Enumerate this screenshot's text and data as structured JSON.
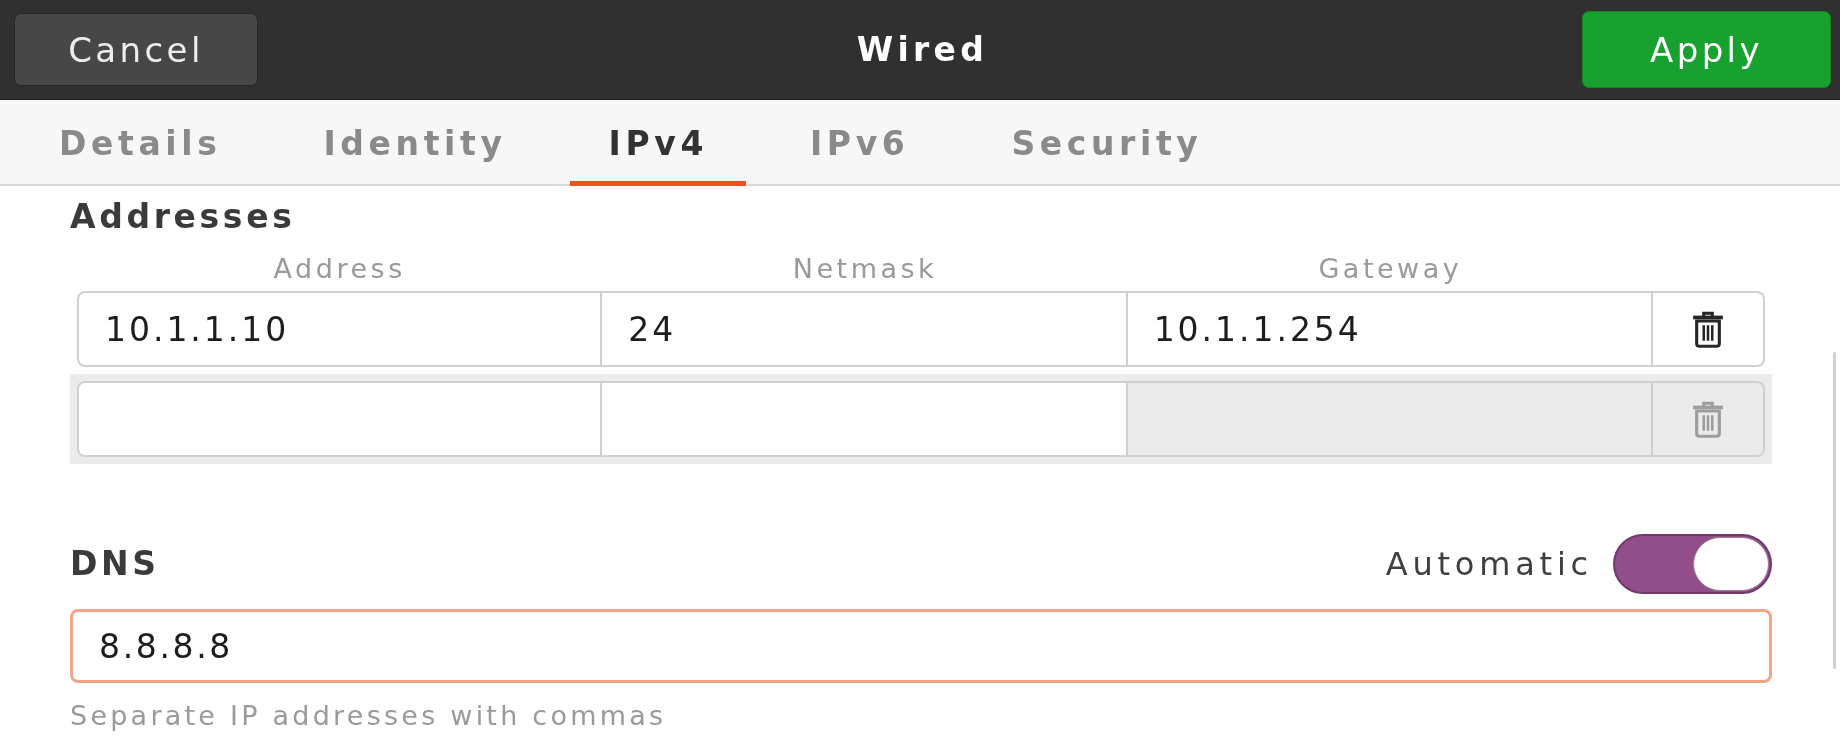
{
  "header": {
    "cancel": "Cancel",
    "title": "Wired",
    "apply": "Apply"
  },
  "tabs": [
    {
      "label": "Details",
      "selected": false
    },
    {
      "label": "Identity",
      "selected": false
    },
    {
      "label": "IPv4",
      "selected": true
    },
    {
      "label": "IPv6",
      "selected": false
    },
    {
      "label": "Security",
      "selected": false
    }
  ],
  "addresses": {
    "title": "Addresses",
    "columns": [
      "Address",
      "Netmask",
      "Gateway"
    ],
    "rows": [
      {
        "highlighted": false,
        "address": "10.1.1.10",
        "netmask": "24",
        "gateway": "10.1.1.254",
        "gateway_disabled": false,
        "delete_disabled": false
      },
      {
        "highlighted": true,
        "gateway_disabled": true,
        "delete_disabled": true
      }
    ]
  },
  "dns": {
    "title": "DNS",
    "automatic_label": "Automatic",
    "automatic_on": true,
    "value": "8.8.8.8",
    "focused": true,
    "hint": "Separate IP addresses with commas"
  }
}
